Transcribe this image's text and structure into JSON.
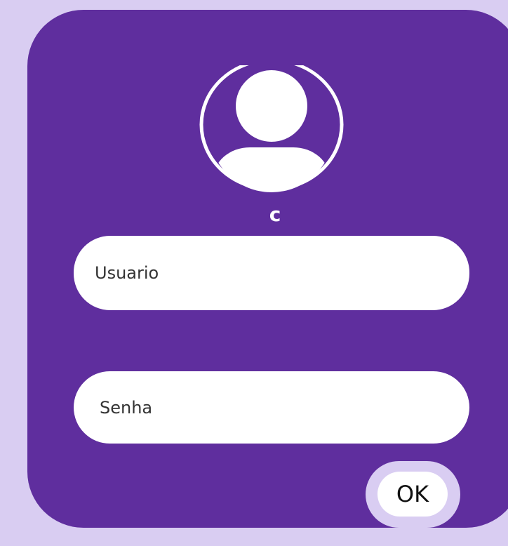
{
  "login": {
    "username": "c",
    "user_field": "Usuario",
    "password_field": "Senha",
    "ok_label": "OK"
  },
  "colors": {
    "background": "#d9cdf2",
    "card": "#5f2e9e",
    "field": "#ffffff",
    "avatar": "#ffffff"
  },
  "icons": {
    "avatar": "user-avatar-icon"
  }
}
